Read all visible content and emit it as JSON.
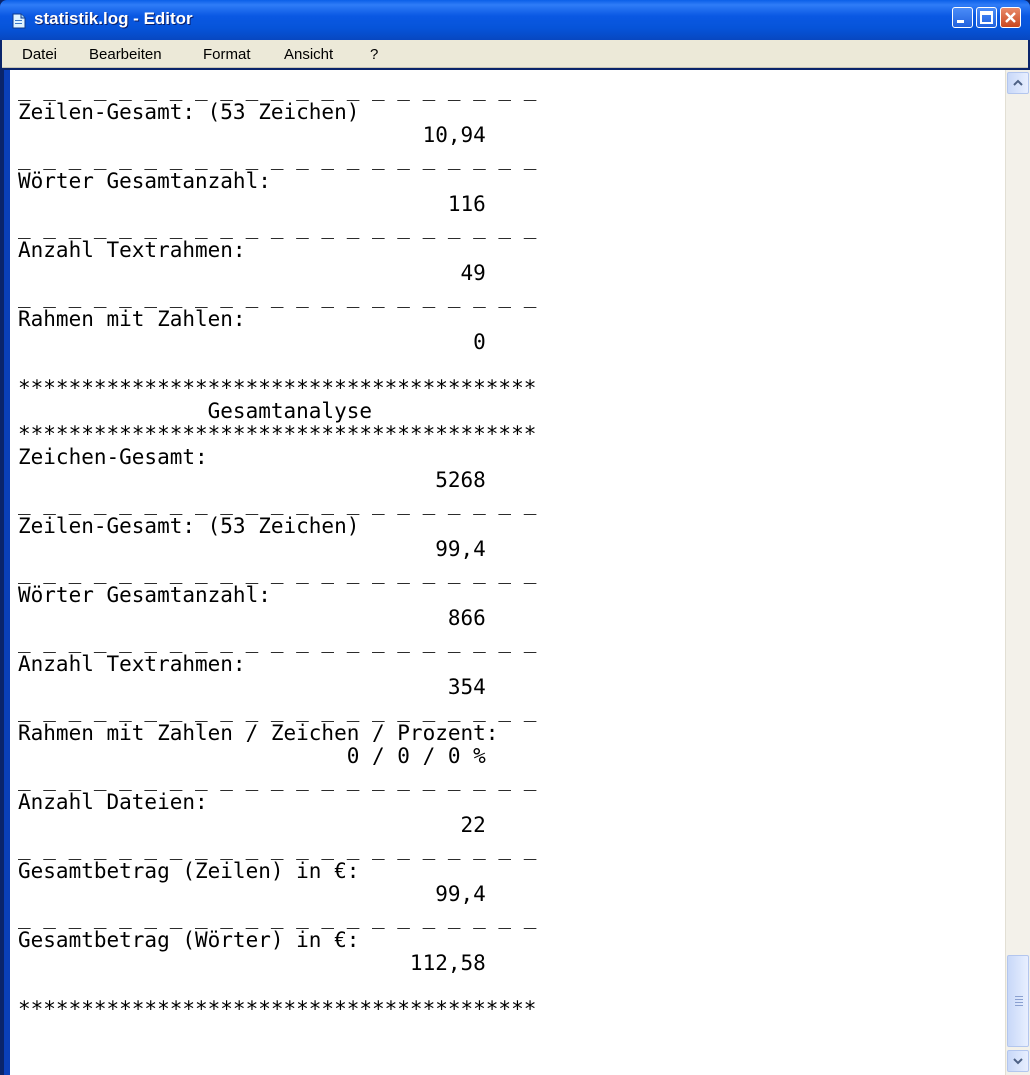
{
  "window": {
    "title": "statistik.log - Editor",
    "icons": {
      "app": "notepad-icon",
      "minimize": "minimize-icon",
      "maximize": "maximize-icon",
      "close": "close-icon"
    },
    "colors": {
      "titlebar": "#0654d9",
      "menubar": "#ece9d8",
      "editor_bg": "#ffffff"
    }
  },
  "menu": [
    {
      "label": "Datei"
    },
    {
      "label": "Bearbeiten"
    },
    {
      "label": "Format"
    },
    {
      "label": "Ansicht"
    },
    {
      "label": "?"
    }
  ],
  "editor": {
    "content": "_ _ _ _ _ _ _ _ _ _ _ _ _ _ _ _ _ _ _ _ _\nZeilen-Gesamt: (53 Zeichen)\n                                10,94\n_ _ _ _ _ _ _ _ _ _ _ _ _ _ _ _ _ _ _ _ _\nWörter Gesamtanzahl:\n                                  116\n_ _ _ _ _ _ _ _ _ _ _ _ _ _ _ _ _ _ _ _ _\nAnzahl Textrahmen:\n                                   49\n_ _ _ _ _ _ _ _ _ _ _ _ _ _ _ _ _ _ _ _ _\nRahmen mit Zahlen:\n                                    0\n\n*****************************************\n               Gesamtanalyse\n*****************************************\nZeichen-Gesamt:\n                                 5268\n_ _ _ _ _ _ _ _ _ _ _ _ _ _ _ _ _ _ _ _ _\nZeilen-Gesamt: (53 Zeichen)\n                                 99,4\n_ _ _ _ _ _ _ _ _ _ _ _ _ _ _ _ _ _ _ _ _\nWörter Gesamtanzahl:\n                                  866\n_ _ _ _ _ _ _ _ _ _ _ _ _ _ _ _ _ _ _ _ _\nAnzahl Textrahmen:\n                                  354\n_ _ _ _ _ _ _ _ _ _ _ _ _ _ _ _ _ _ _ _ _\nRahmen mit Zahlen / Zeichen / Prozent:\n                          0 / 0 / 0 %\n_ _ _ _ _ _ _ _ _ _ _ _ _ _ _ _ _ _ _ _ _\nAnzahl Dateien:\n                                   22\n_ _ _ _ _ _ _ _ _ _ _ _ _ _ _ _ _ _ _ _ _\nGesamtbetrag (Zeilen) in €:\n                                 99,4\n_ _ _ _ _ _ _ _ _ _ _ _ _ _ _ _ _ _ _ _ _\nGesamtbetrag (Wörter) in €:\n                               112,58\n\n*****************************************"
  },
  "scrollbar": {
    "up_icon": "scroll-up-arrow-icon",
    "down_icon": "scroll-down-arrow-icon"
  }
}
